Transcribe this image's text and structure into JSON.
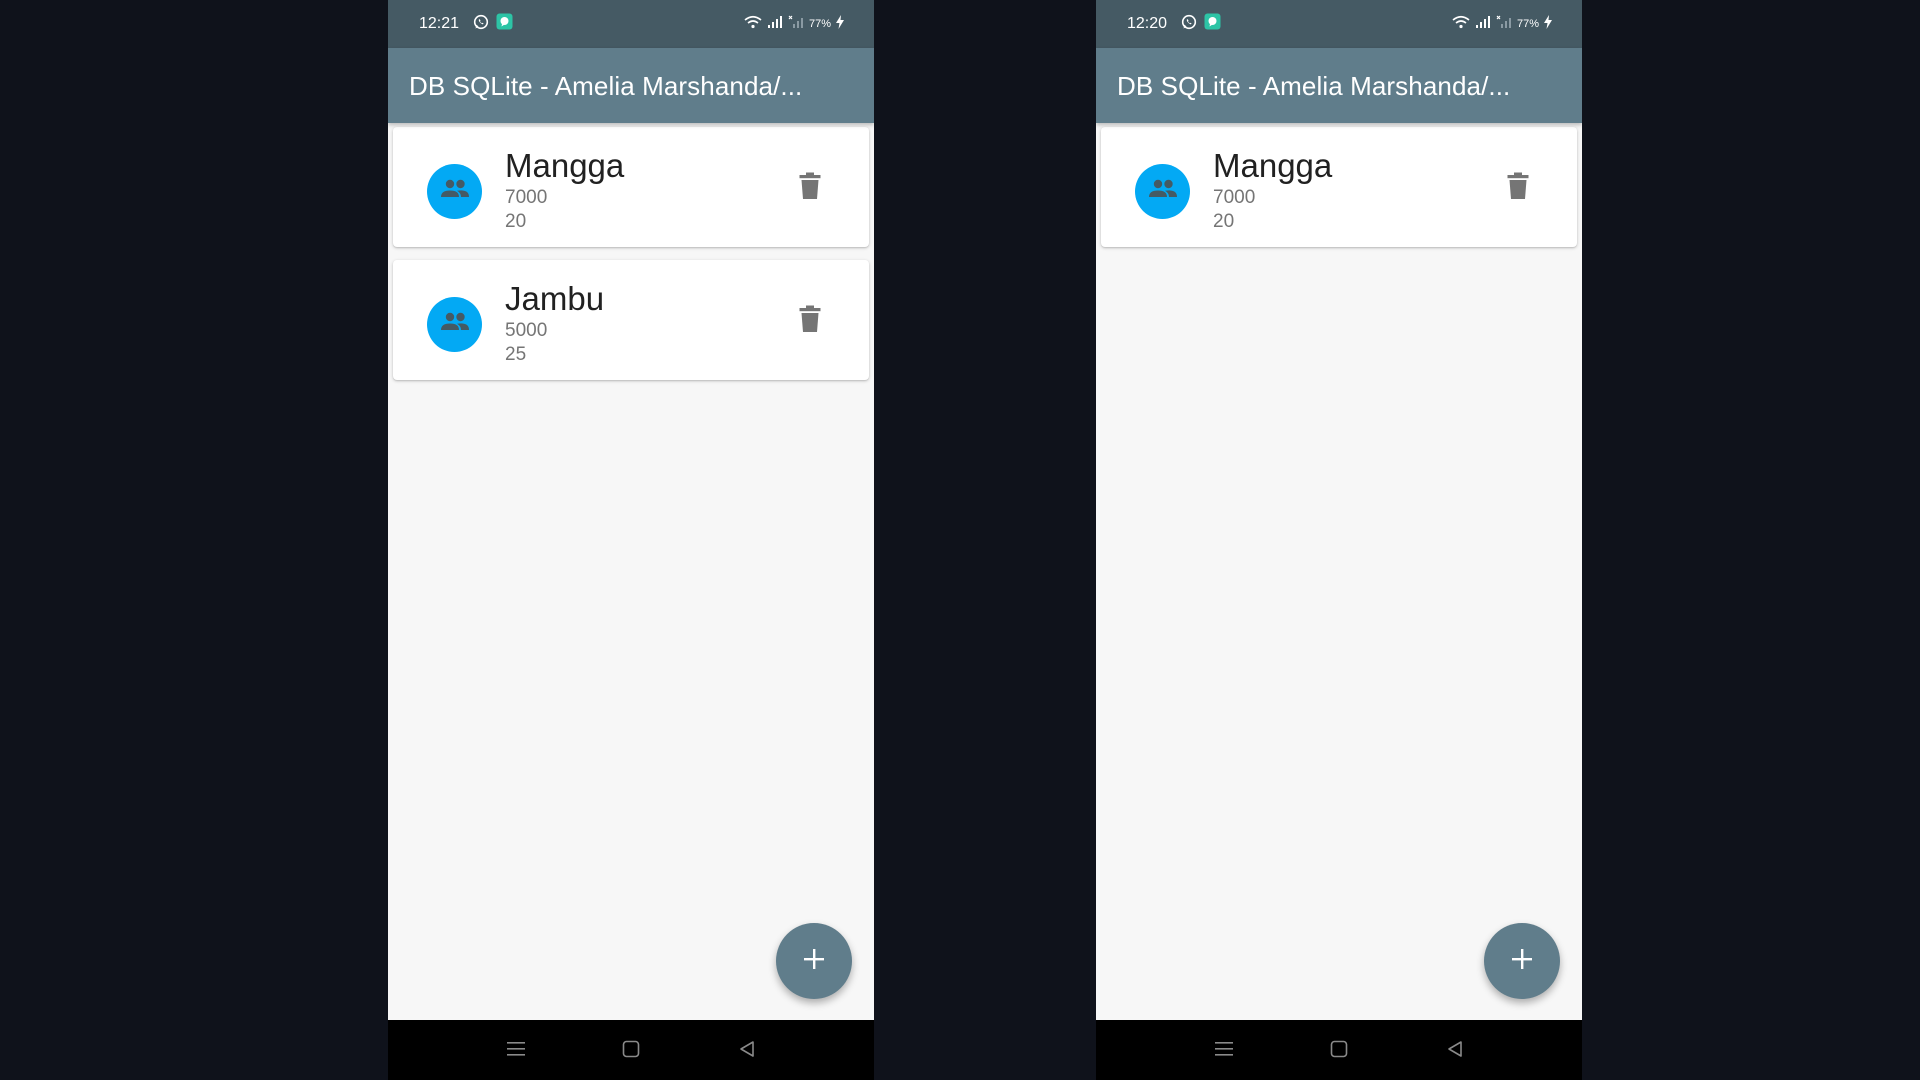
{
  "screens": [
    {
      "status": {
        "time": "12:21",
        "battery": "77%"
      },
      "app_bar": {
        "title": "DB SQLite - Amelia Marshanda/..."
      },
      "items": [
        {
          "name": "Mangga",
          "price": "7000",
          "qty": "20"
        },
        {
          "name": "Jambu",
          "price": "5000",
          "qty": "25"
        }
      ],
      "fab": {
        "icon": "plus-icon"
      },
      "nav": [
        "menu-icon",
        "home-icon",
        "back-icon"
      ]
    },
    {
      "status": {
        "time": "12:20",
        "battery": "77%"
      },
      "app_bar": {
        "title": "DB SQLite - Amelia Marshanda/..."
      },
      "items": [
        {
          "name": "Mangga",
          "price": "7000",
          "qty": "20"
        }
      ],
      "fab": {
        "icon": "plus-icon"
      },
      "nav": [
        "menu-icon",
        "home-icon",
        "back-icon"
      ]
    }
  ],
  "colors": {
    "status_bar": "#455a64",
    "app_bar": "#607d8b",
    "avatar": "#03a9f4",
    "background": "#0f121b"
  }
}
